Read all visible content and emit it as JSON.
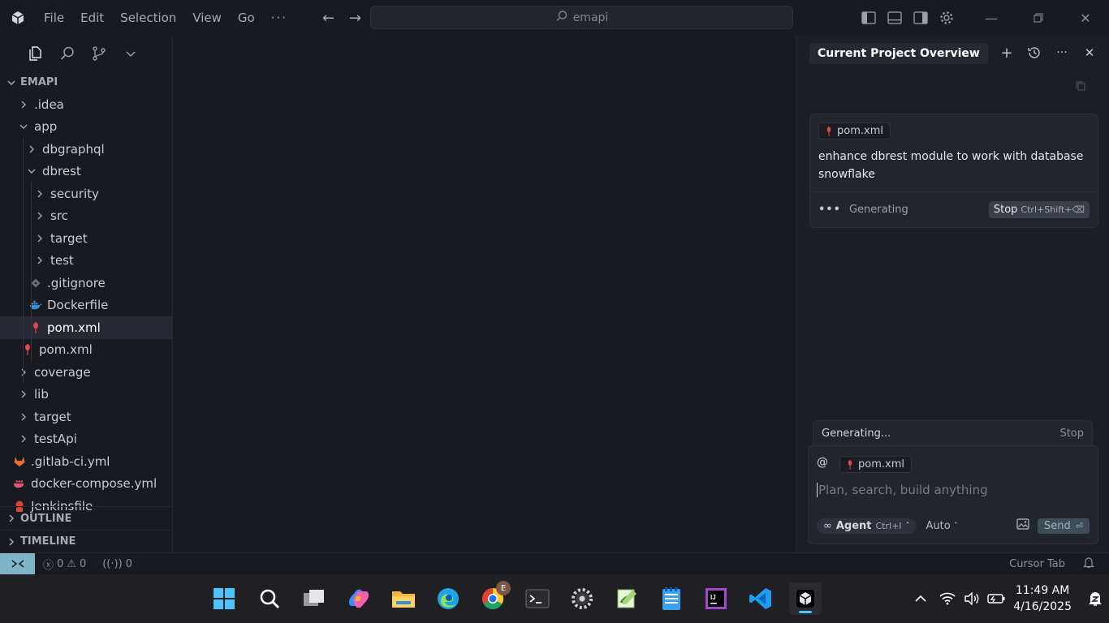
{
  "titlebar": {
    "menus": [
      "File",
      "Edit",
      "Selection",
      "View",
      "Go",
      "···"
    ],
    "search_text": "emapi"
  },
  "sidebar": {
    "tabs": [
      "explorer-icon",
      "search-icon",
      "source-control-icon",
      "chevron-down-icon"
    ],
    "root_label": "EMAPI",
    "tree": [
      {
        "label": ".idea",
        "depth": 1,
        "kind": "folder"
      },
      {
        "label": "app",
        "depth": 1,
        "kind": "folder-open"
      },
      {
        "label": "dbgraphql",
        "depth": 2,
        "kind": "folder"
      },
      {
        "label": "dbrest",
        "depth": 2,
        "kind": "folder-open"
      },
      {
        "label": "security",
        "depth": 3,
        "kind": "folder"
      },
      {
        "label": "src",
        "depth": 3,
        "kind": "folder"
      },
      {
        "label": "target",
        "depth": 3,
        "kind": "folder"
      },
      {
        "label": "test",
        "depth": 3,
        "kind": "folder"
      },
      {
        "label": ".gitignore",
        "depth": 3,
        "kind": "git"
      },
      {
        "label": "Dockerfile",
        "depth": 3,
        "kind": "docker"
      },
      {
        "label": "pom.xml",
        "depth": 3,
        "kind": "maven",
        "selected": true
      },
      {
        "label": "pom.xml",
        "depth": 2,
        "kind": "maven"
      },
      {
        "label": "coverage",
        "depth": 1,
        "kind": "folder"
      },
      {
        "label": "lib",
        "depth": 1,
        "kind": "folder"
      },
      {
        "label": "target",
        "depth": 1,
        "kind": "folder"
      },
      {
        "label": "testApi",
        "depth": 1,
        "kind": "folder"
      },
      {
        "label": ".gitlab-ci.yml",
        "depth": 1,
        "kind": "gitlab"
      },
      {
        "label": "docker-compose.yml",
        "depth": 1,
        "kind": "compose"
      },
      {
        "label": "Jenkinsfile",
        "depth": 1,
        "kind": "jenkins"
      }
    ],
    "outline_label": "OUTLINE",
    "timeline_label": "TIMELINE"
  },
  "chat": {
    "title": "Current Project Overview",
    "message": {
      "context_chip": "pom.xml",
      "text": "enhance dbrest module to work with database snowflake",
      "status": "Generating",
      "stop_label": "Stop",
      "stop_shortcut": "Ctrl+Shift+⌫"
    },
    "gen_bar": {
      "label": "Generating...",
      "stop": "Stop"
    },
    "composer": {
      "at_symbol": "@",
      "context_chip": "pom.xml",
      "placeholder": "Plan, search, build anything",
      "mode_label": "Agent",
      "mode_shortcut": "Ctrl+I",
      "model_label": "Auto",
      "send_label": "Send"
    }
  },
  "statusbar": {
    "errors": "0",
    "warnings": "0",
    "ports": "0",
    "cursor_tab": "Cursor Tab"
  },
  "taskbar": {
    "apps": [
      "windows-start-icon",
      "search-icon",
      "task-view-icon",
      "copilot-icon",
      "file-explorer-icon",
      "edge-icon",
      "chrome-icon",
      "terminal-icon",
      "settings-app-icon",
      "notepadpp-icon",
      "notepad-icon",
      "intellij-icon",
      "vscode-icon",
      "cursor-icon"
    ],
    "chrome_badge": "E",
    "time": "11:49 AM",
    "date": "4/16/2025"
  },
  "colors": {
    "background": "#181a20",
    "selected_row": "#262932",
    "remote_indicator": "#7fb5c7",
    "maven_red": "#e04a4a"
  }
}
